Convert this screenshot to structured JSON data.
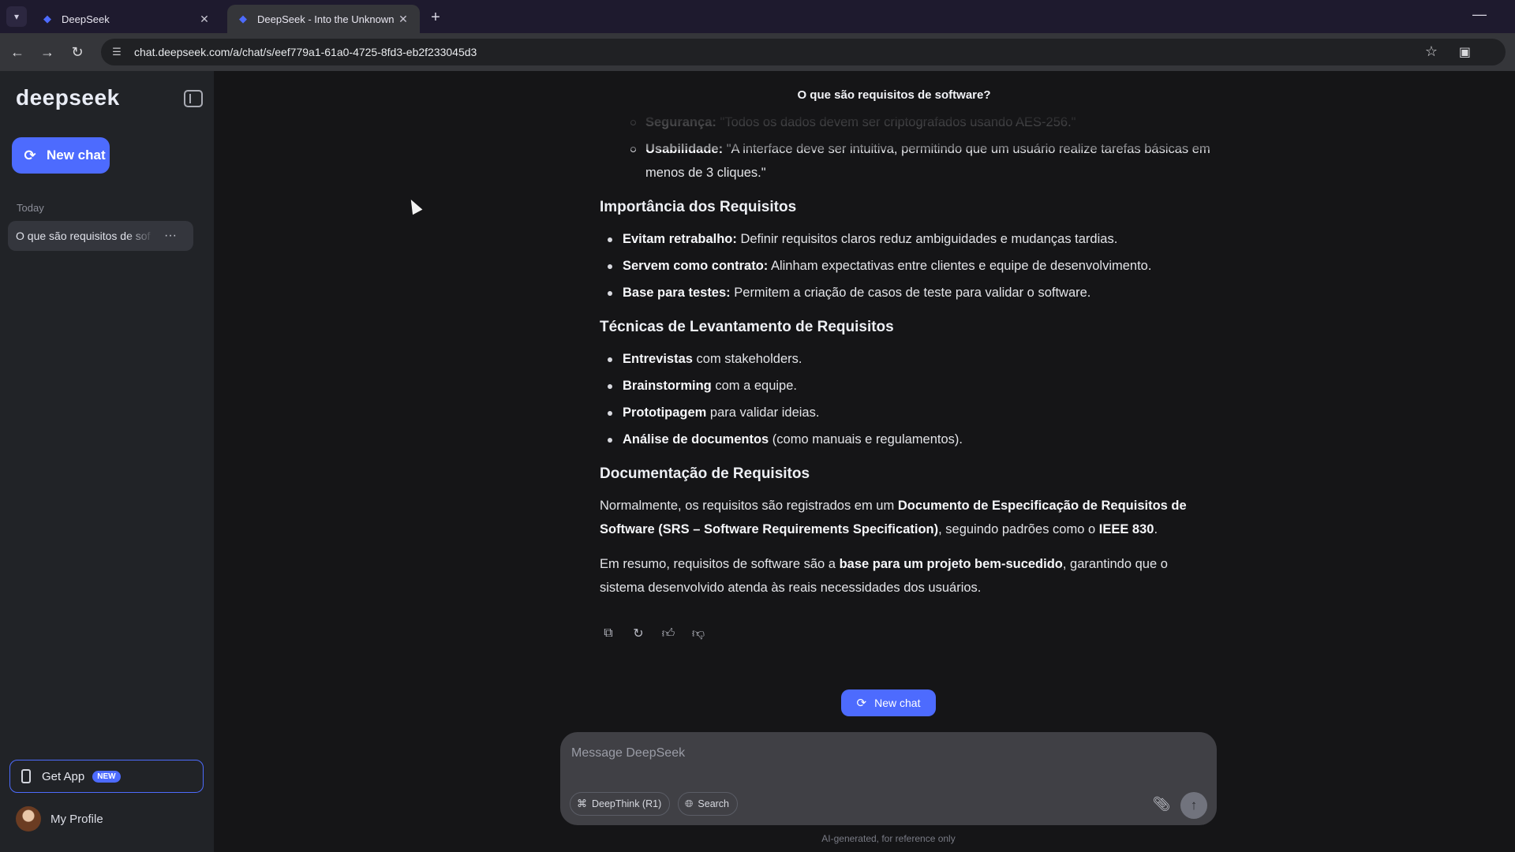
{
  "browser": {
    "tabs": [
      {
        "title": "DeepSeek",
        "active": false
      },
      {
        "title": "DeepSeek - Into the Unknown",
        "active": true
      }
    ],
    "url": "chat.deepseek.com/a/chat/s/eef779a1-61a0-4725-8fd3-eb2f233045d3",
    "icons": {
      "back": "arrow-left-icon",
      "forward": "arrow-right-icon",
      "reload": "reload-icon",
      "star": "star-icon"
    }
  },
  "sidebar": {
    "logo": "deepseek",
    "new_chat_label": "New chat",
    "section_label": "Today",
    "history": [
      {
        "label": "O que são requisitos de sof"
      }
    ],
    "get_app_label": "Get App",
    "get_app_badge": "NEW",
    "profile_label": "My Profile"
  },
  "chat": {
    "title": "O que são requisitos de software?",
    "top_items": [
      {
        "bold": "Segurança:",
        "text": " \"Todos os dados devem ser criptografados usando AES-256.\""
      },
      {
        "bold": "Usabilidade:",
        "text": " \"A interface deve ser intuitiva, permitindo que um usuário realize tarefas básicas em menos de 3 cliques.\""
      }
    ],
    "sections": [
      {
        "heading": "Importância dos Requisitos",
        "items": [
          {
            "bold": "Evitam retrabalho:",
            "text": " Definir requisitos claros reduz ambiguidades e mudanças tardias."
          },
          {
            "bold": "Servem como contrato:",
            "text": " Alinham expectativas entre clientes e equipe de desenvolvimento."
          },
          {
            "bold": "Base para testes:",
            "text": " Permitem a criação de casos de teste para validar o software."
          }
        ]
      },
      {
        "heading": "Técnicas de Levantamento de Requisitos",
        "items": [
          {
            "bold": "Entrevistas",
            "text": " com stakeholders."
          },
          {
            "bold": "Brainstorming",
            "text": " com a equipe."
          },
          {
            "bold": "Prototipagem",
            "text": " para validar ideias."
          },
          {
            "bold": "Análise de documentos",
            "text": " (como manuais e regulamentos)."
          }
        ]
      }
    ],
    "doc_heading": "Documentação de Requisitos",
    "doc_para": {
      "t1": "Normalmente, os requisitos são registrados em um ",
      "b1": "Documento de Especificação de Requisitos de Software (SRS – Software Requirements Specification)",
      "t2": ", seguindo padrões como o ",
      "b2": "IEEE 830",
      "t3": "."
    },
    "summary_para": {
      "t1": "Em resumo, requisitos de software são a ",
      "b1": "base para um projeto bem-sucedido",
      "t2": ", garantindo que o sistema desenvolvido atenda às reais necessidades dos usuários."
    },
    "new_chat_label": "New chat"
  },
  "composer": {
    "placeholder": "Message DeepSeek",
    "deepthink_label": "DeepThink (R1)",
    "search_label": "Search",
    "disclaimer": "AI-generated, for reference only"
  },
  "colors": {
    "accent": "#4d6bfe",
    "background": "#151517",
    "sidebar": "#212327"
  }
}
